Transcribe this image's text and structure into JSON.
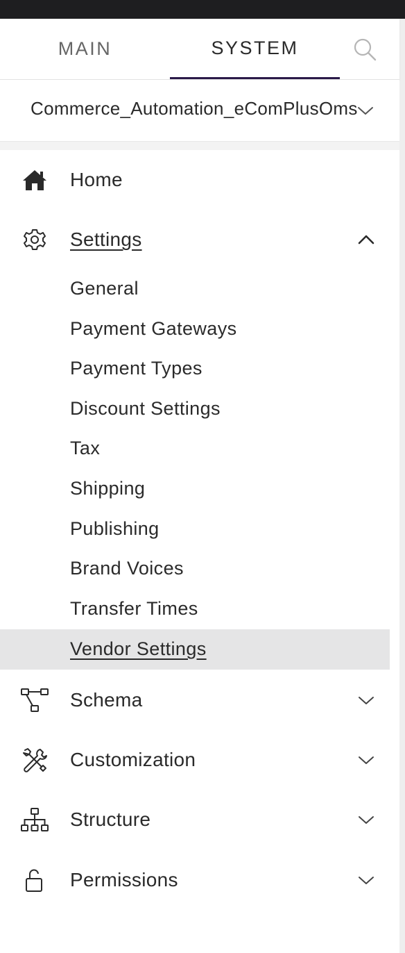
{
  "tabs": [
    {
      "label": "MAIN",
      "active": false
    },
    {
      "label": "SYSTEM",
      "active": true
    }
  ],
  "search": {
    "icon": "search-icon"
  },
  "instance": {
    "name": "Commerce_Automation_eComPlusOms",
    "icon": "chevron-down-icon"
  },
  "nav": {
    "home": {
      "label": "Home",
      "icon": "home-icon"
    },
    "settings": {
      "label": "Settings",
      "icon": "gear-icon",
      "expanded": true,
      "items": [
        {
          "label": "General"
        },
        {
          "label": "Payment Gateways"
        },
        {
          "label": "Payment Types"
        },
        {
          "label": "Discount Settings"
        },
        {
          "label": "Tax"
        },
        {
          "label": "Shipping"
        },
        {
          "label": "Publishing"
        },
        {
          "label": "Brand Voices"
        },
        {
          "label": "Transfer Times"
        },
        {
          "label": "Vendor Settings",
          "active": true
        }
      ]
    },
    "schema": {
      "label": "Schema",
      "icon": "schema-icon"
    },
    "customization": {
      "label": "Customization",
      "icon": "tools-icon"
    },
    "structure": {
      "label": "Structure",
      "icon": "hierarchy-icon"
    },
    "permissions": {
      "label": "Permissions",
      "icon": "lock-icon"
    }
  },
  "colors": {
    "tab_indicator": "#2b1a49",
    "active_item_bg": "#e5e5e6",
    "top_bar": "#1e1e20"
  }
}
